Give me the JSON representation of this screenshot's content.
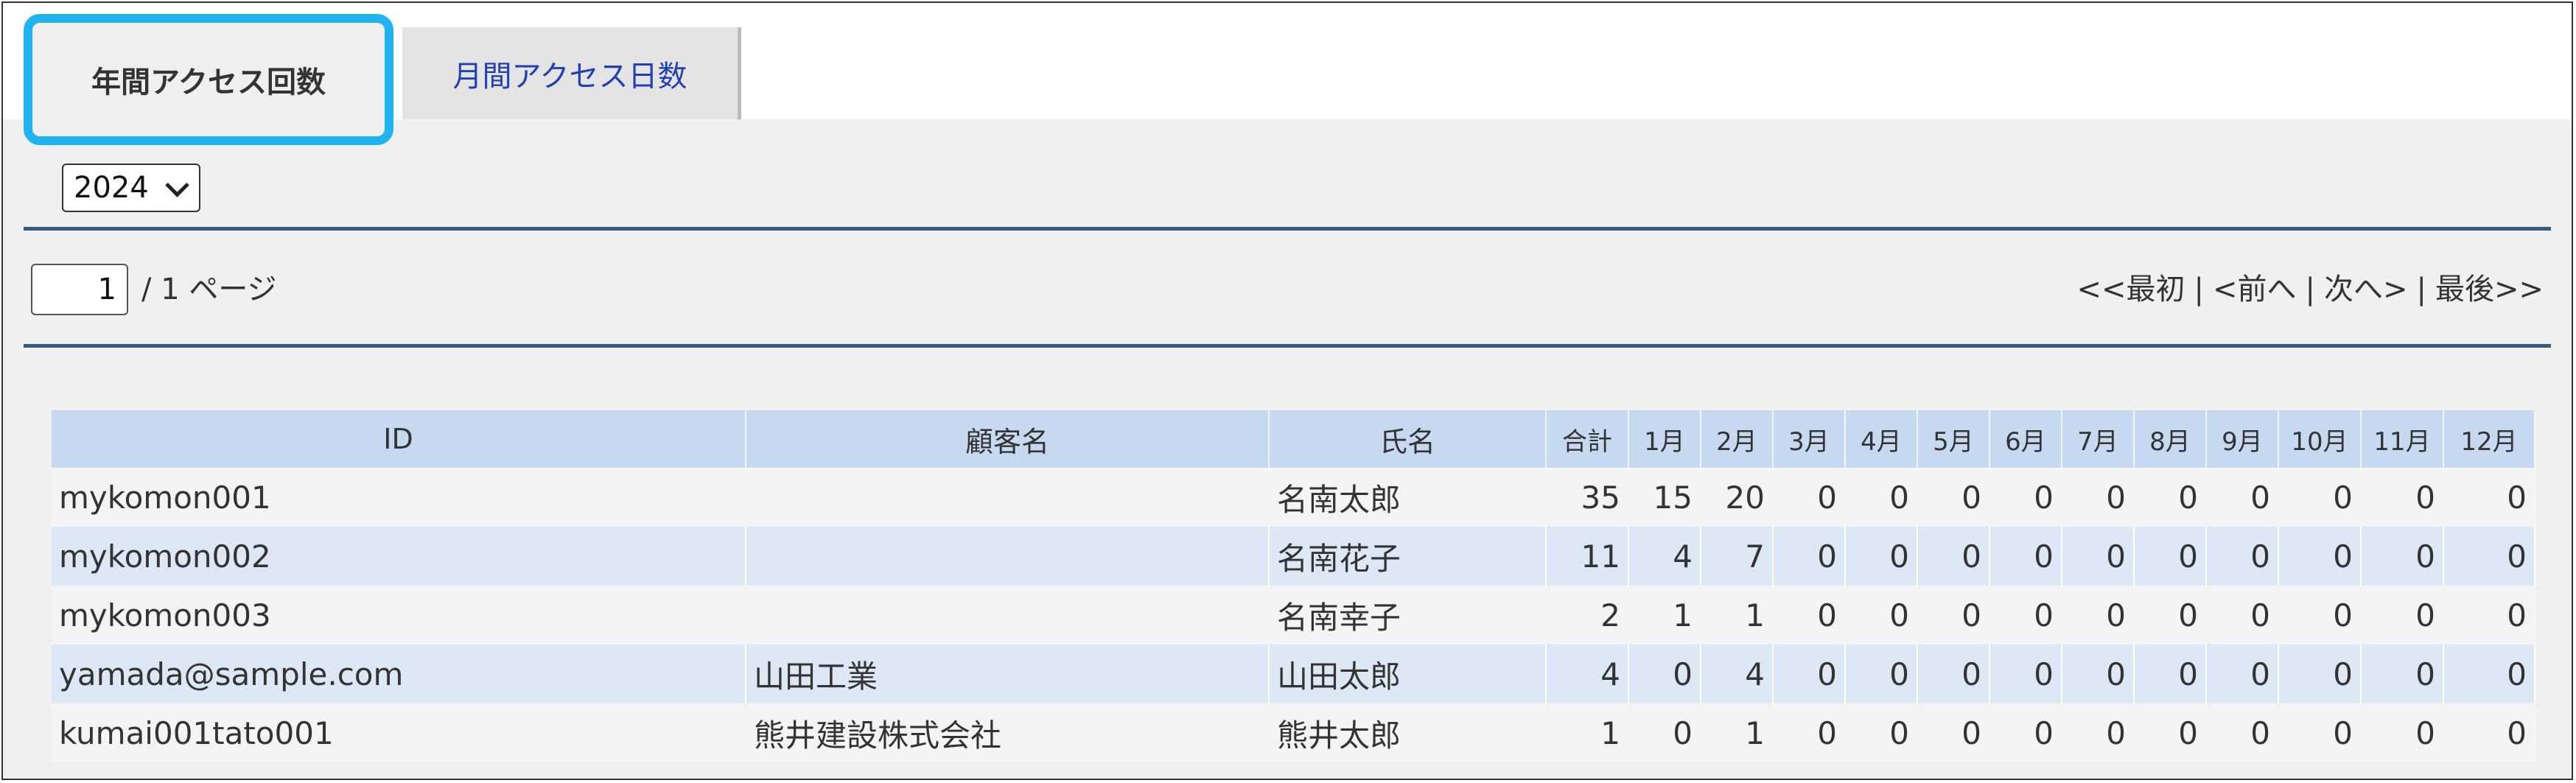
{
  "tabs": {
    "annual": "年間アクセス回数",
    "monthly": "月間アクセス日数"
  },
  "year_select": {
    "value": "2024"
  },
  "pager": {
    "current": "1",
    "total": "/ 1 ページ",
    "first": "<<最初",
    "prev": "<前へ",
    "next": "次へ>",
    "last": "最後>>",
    "separator": "|"
  },
  "table": {
    "headers": [
      "ID",
      "顧客名",
      "氏名",
      "合計",
      "1月",
      "2月",
      "3月",
      "4月",
      "5月",
      "6月",
      "7月",
      "8月",
      "9月",
      "10月",
      "11月",
      "12月"
    ],
    "rows": [
      [
        "mykomon001",
        "",
        "名南太郎",
        "35",
        "15",
        "20",
        "0",
        "0",
        "0",
        "0",
        "0",
        "0",
        "0",
        "0",
        "0",
        "0"
      ],
      [
        "mykomon002",
        "",
        "名南花子",
        "11",
        "4",
        "7",
        "0",
        "0",
        "0",
        "0",
        "0",
        "0",
        "0",
        "0",
        "0",
        "0"
      ],
      [
        "mykomon003",
        "",
        "名南幸子",
        "2",
        "1",
        "1",
        "0",
        "0",
        "0",
        "0",
        "0",
        "0",
        "0",
        "0",
        "0",
        "0"
      ],
      [
        "yamada@sample.com",
        "山田工業",
        "山田太郎",
        "4",
        "0",
        "4",
        "0",
        "0",
        "0",
        "0",
        "0",
        "0",
        "0",
        "0",
        "0",
        "0"
      ],
      [
        "kumai001tato001",
        "熊井建設株式会社",
        "熊井太郎",
        "1",
        "0",
        "1",
        "0",
        "0",
        "0",
        "0",
        "0",
        "0",
        "0",
        "0",
        "0",
        "0"
      ]
    ]
  },
  "colors": {
    "tab_highlight": "#1fb4ef",
    "header_bg": "#c6d9f0",
    "rule": "#3b5a80",
    "tab_link": "#2040b8"
  }
}
